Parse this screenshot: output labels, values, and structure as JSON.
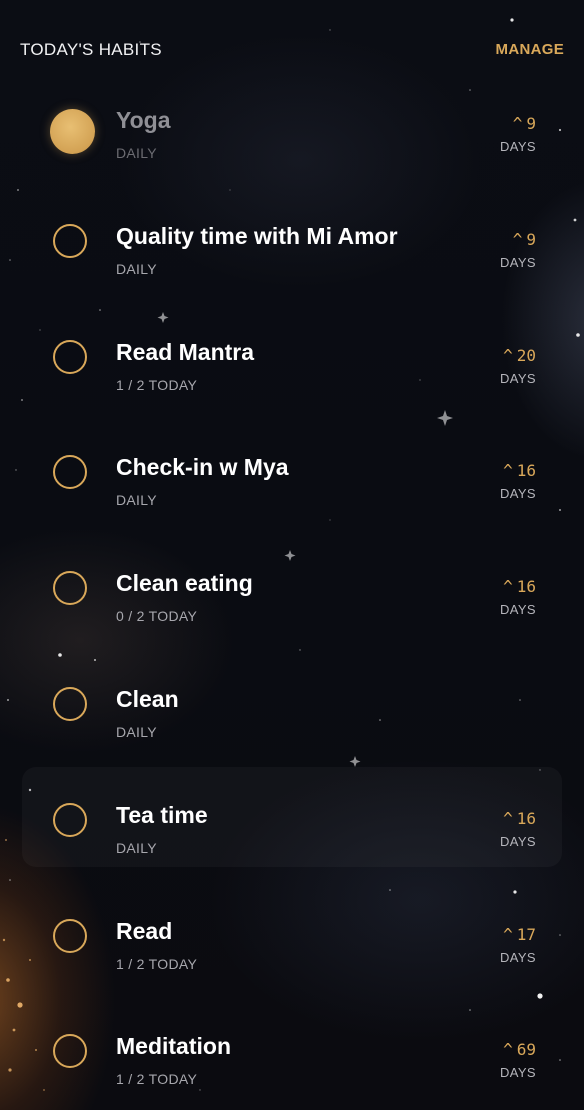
{
  "header": {
    "title": "TODAY'S HABITS",
    "manage_label": "MANAGE"
  },
  "colors": {
    "accent": "#d9a85a",
    "text_primary": "#ffffff",
    "text_secondary": "#a7a7ad",
    "completed_text": "#8f8f95",
    "background": "#0b0d14"
  },
  "icons": {
    "streak_arrow": "chevron-up-icon",
    "check": "circle-check-icon"
  },
  "habits": [
    {
      "name": "Yoga",
      "subtitle": "DAILY",
      "streak_arrow": "^",
      "streak": "9",
      "streak_unit": "DAYS",
      "completed": true
    },
    {
      "name": "Quality time with Mi Amor",
      "subtitle": "DAILY",
      "streak_arrow": "^",
      "streak": "9",
      "streak_unit": "DAYS",
      "completed": false
    },
    {
      "name": "Read Mantra",
      "subtitle": "1 / 2 TODAY",
      "streak_arrow": "^",
      "streak": "20",
      "streak_unit": "DAYS",
      "completed": false
    },
    {
      "name": "Check-in w Mya",
      "subtitle": "DAILY",
      "streak_arrow": "^",
      "streak": "16",
      "streak_unit": "DAYS",
      "completed": false
    },
    {
      "name": "Clean eating",
      "subtitle": "0 / 2 TODAY",
      "streak_arrow": "^",
      "streak": "16",
      "streak_unit": "DAYS",
      "completed": false
    },
    {
      "name": "Clean",
      "subtitle": "DAILY",
      "streak_arrow": "",
      "streak": "",
      "streak_unit": "",
      "completed": false
    },
    {
      "name": "Tea time",
      "subtitle": "DAILY",
      "streak_arrow": "^",
      "streak": "16",
      "streak_unit": "DAYS",
      "completed": false
    },
    {
      "name": "Read",
      "subtitle": "1 / 2 TODAY",
      "streak_arrow": "^",
      "streak": "17",
      "streak_unit": "DAYS",
      "completed": false
    },
    {
      "name": "Meditation",
      "subtitle": "1 / 2 TODAY",
      "streak_arrow": "^",
      "streak": "69",
      "streak_unit": "DAYS",
      "completed": false
    }
  ]
}
